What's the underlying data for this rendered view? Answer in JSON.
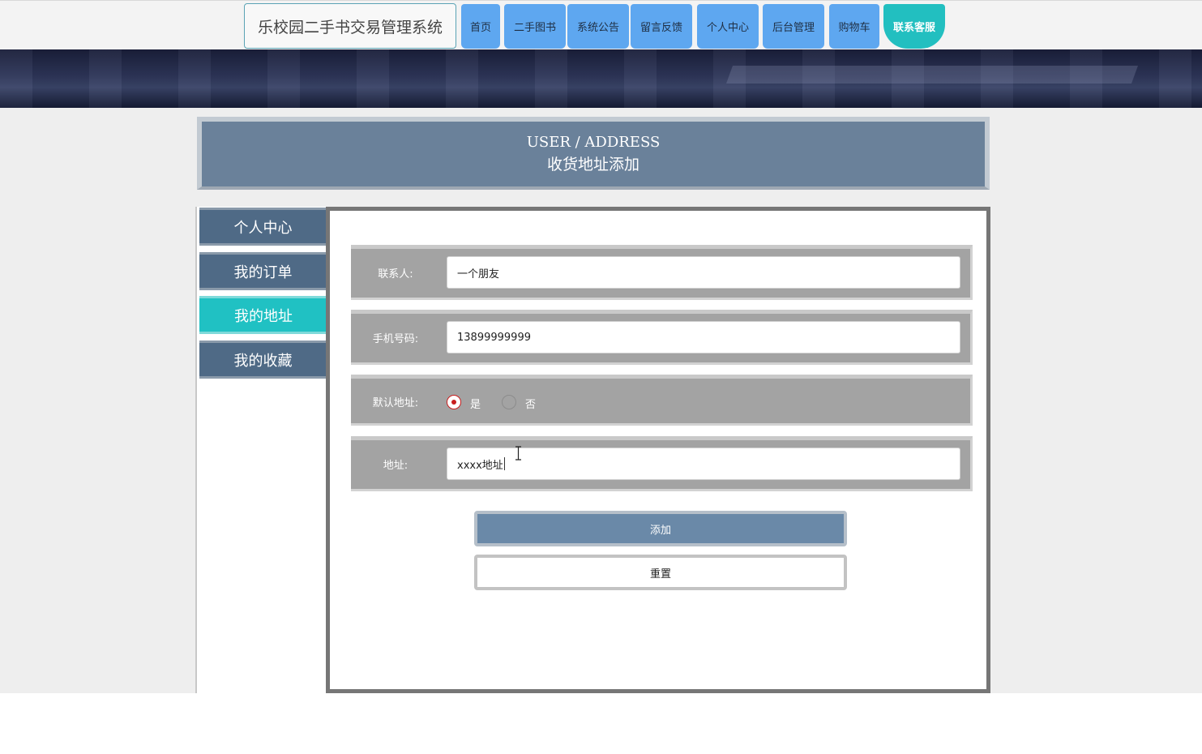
{
  "site": {
    "title": "乐校园二手书交易管理系统"
  },
  "nav": {
    "items": [
      {
        "label": "首页"
      },
      {
        "label": "二手图书"
      },
      {
        "label": "系统公告"
      },
      {
        "label": "留言反馈"
      },
      {
        "label": "个人中心"
      },
      {
        "label": "后台管理"
      },
      {
        "label": "购物车"
      },
      {
        "label": "联系客服",
        "active": true
      }
    ]
  },
  "header": {
    "en": "USER / ADDRESS",
    "cn": "收货地址添加"
  },
  "sidebar": {
    "items": [
      {
        "label": "个人中心"
      },
      {
        "label": "我的订单"
      },
      {
        "label": "我的地址",
        "active": true
      },
      {
        "label": "我的收藏"
      }
    ]
  },
  "form": {
    "contact": {
      "label": "联系人:",
      "value": "一个朋友"
    },
    "phone": {
      "label": "手机号码:",
      "value": "13899999999"
    },
    "default": {
      "label": "默认地址:",
      "yes": "是",
      "no": "否",
      "selected": "是"
    },
    "address": {
      "label": "地址:",
      "value": "xxxx地址"
    },
    "add_label": "添加",
    "reset_label": "重置"
  },
  "colors": {
    "nav_button": "#5ea7f0",
    "nav_active": "#22bfc0",
    "sidebar_item": "#4f6a86",
    "sidebar_active": "#20c1c3",
    "header_bg": "#6a819a",
    "radio_checked": "#c81e1e"
  }
}
